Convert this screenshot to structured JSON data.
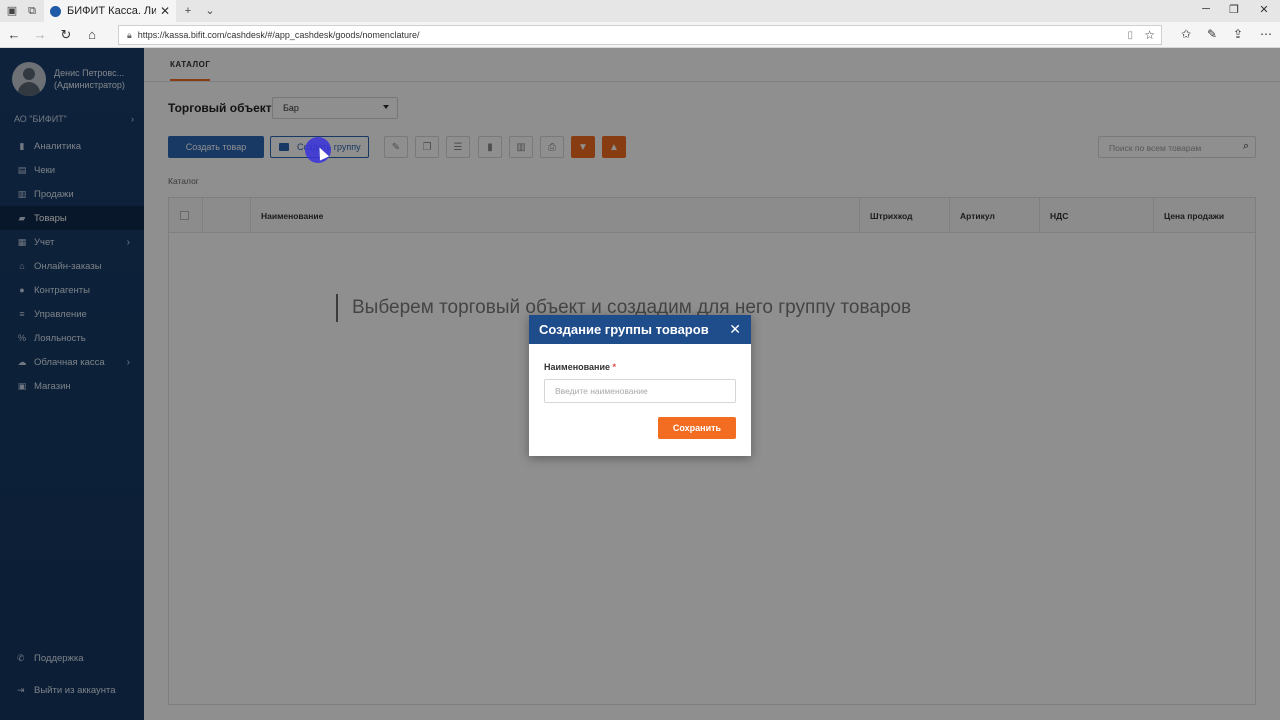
{
  "browser": {
    "tab_title": "БИФИТ Касса. Личный",
    "url": "https://kassa.bifit.com/cashdesk/#/app_cashdesk/goods/nomenclature/"
  },
  "sidebar": {
    "user_name": "Денис Петровс...",
    "user_role": "(Администратор)",
    "org": "АО \"БИФИТ\"",
    "items": [
      {
        "label": "Аналитика",
        "icon": "chart-icon"
      },
      {
        "label": "Чеки",
        "icon": "receipt-icon"
      },
      {
        "label": "Продажи",
        "icon": "sales-icon"
      },
      {
        "label": "Товары",
        "icon": "folder-icon"
      },
      {
        "label": "Учет",
        "icon": "accounting-icon"
      },
      {
        "label": "Онлайн-заказы",
        "icon": "basket-icon"
      },
      {
        "label": "Контрагенты",
        "icon": "users-icon"
      },
      {
        "label": "Управление",
        "icon": "settings-icon"
      },
      {
        "label": "Лояльность",
        "icon": "percent-icon"
      },
      {
        "label": "Облачная касса",
        "icon": "cloud-icon"
      },
      {
        "label": "Магазин",
        "icon": "shop-icon"
      }
    ],
    "active": "Товары",
    "support": "Поддержка",
    "logout": "Выйти из аккаунта"
  },
  "main": {
    "tab": "КАТАЛОГ",
    "trade_object_label": "Торговый объект",
    "trade_object_value": "Бар",
    "create_product": "Создать товар",
    "create_group": "Создать группу",
    "search_placeholder": "Поиск по всем товарам",
    "breadcrumb": "Каталог",
    "columns": [
      "Наименование",
      "Штрихкод",
      "Артикул",
      "НДС",
      "Цена продажи"
    ],
    "hint": "Выберем торговый объект и создадим для него группу товаров"
  },
  "modal": {
    "title": "Создание группы товаров",
    "field_label": "Наименование",
    "required_mark": "*",
    "placeholder": "Введите наименование",
    "save": "Сохранить"
  },
  "colors": {
    "sidebar": "#1a3d6a",
    "primary": "#2b66b1",
    "accent": "#f26c21",
    "modal_header": "#1f4c8a"
  }
}
